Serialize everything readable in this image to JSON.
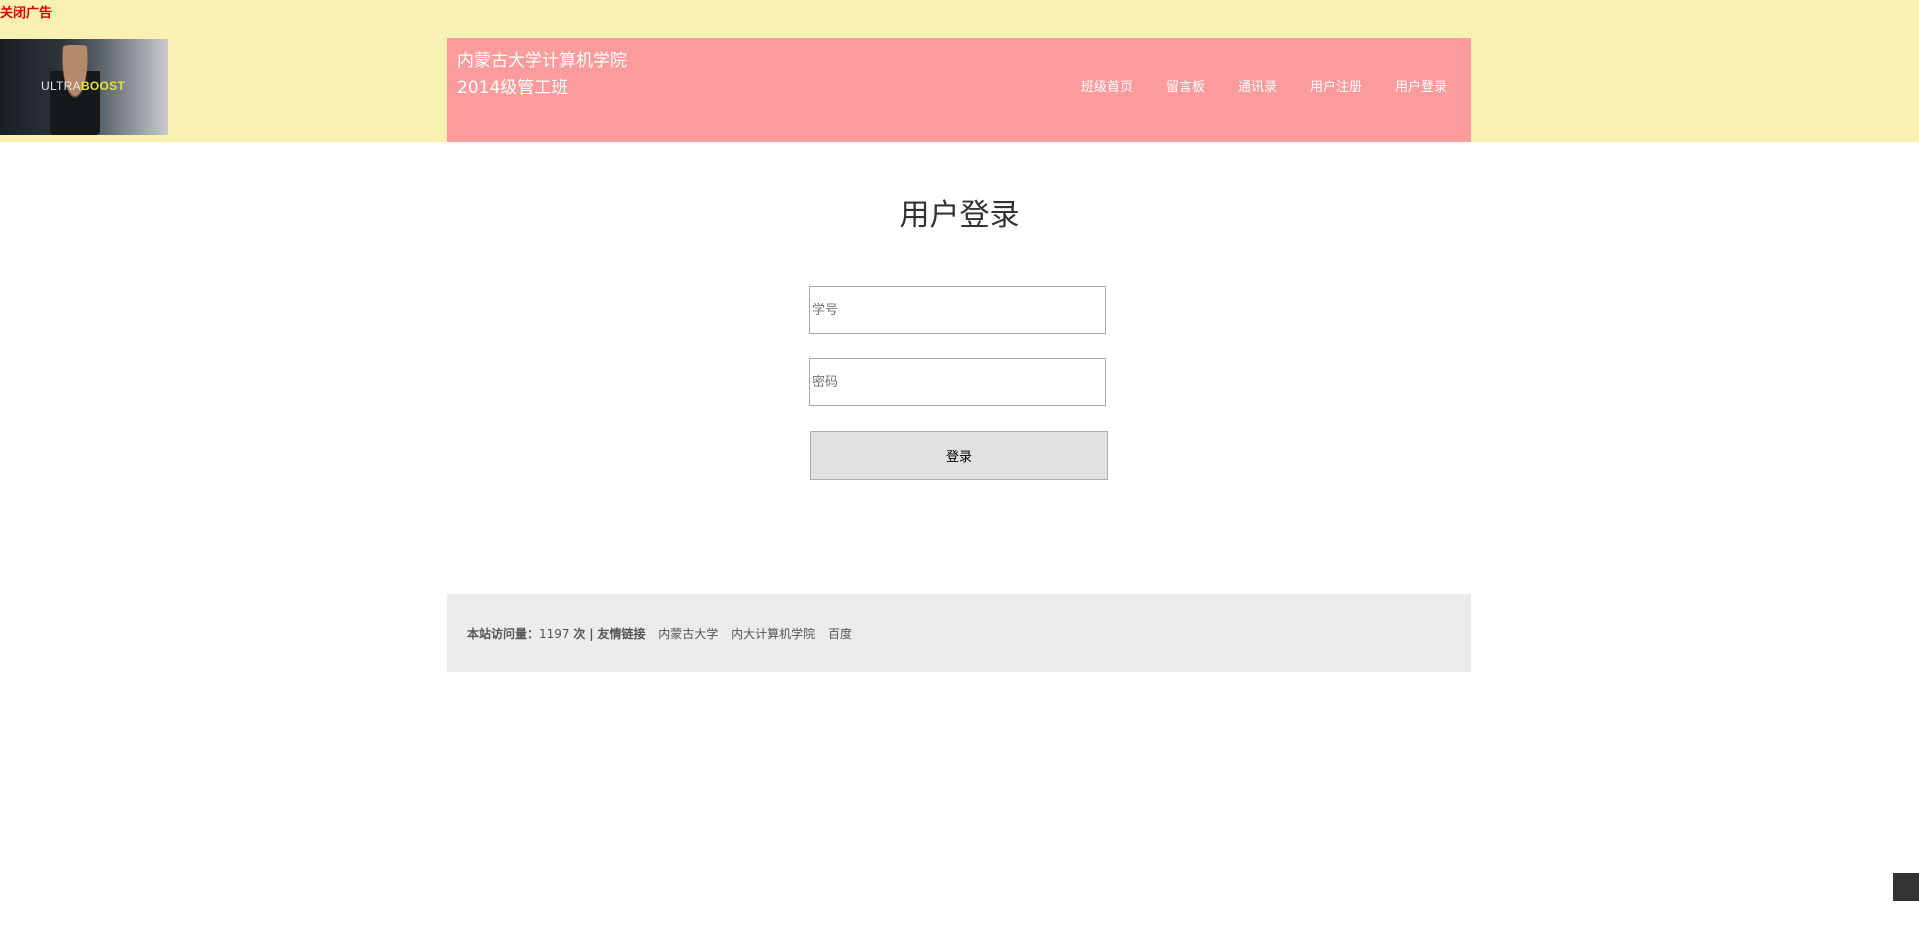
{
  "ad": {
    "close_label": "关闭广告",
    "image_text_light": "ULTRA",
    "image_text_bold": "BOOST"
  },
  "header": {
    "title_line1": "内蒙古大学计算机学院",
    "title_line2": "2014级管工班",
    "nav": [
      {
        "label": "班级首页"
      },
      {
        "label": "留言板"
      },
      {
        "label": "通讯录"
      },
      {
        "label": "用户注册"
      },
      {
        "label": "用户登录"
      }
    ]
  },
  "login": {
    "title": "用户登录",
    "student_id_placeholder": "学号",
    "password_placeholder": "密码",
    "submit_label": "登录"
  },
  "footer": {
    "visits_label": "本站访问量：",
    "visits_count": "1197",
    "visits_unit": "次",
    "separator": "|",
    "links_label": "友情链接",
    "links": [
      {
        "label": "内蒙古大学"
      },
      {
        "label": "内大计算机学院"
      },
      {
        "label": "百度"
      }
    ]
  },
  "colors": {
    "top_band": "#f9f0b4",
    "header_bar": "#fb9b9b",
    "close_ad": "#e00000",
    "footer_bg": "#ececec"
  }
}
